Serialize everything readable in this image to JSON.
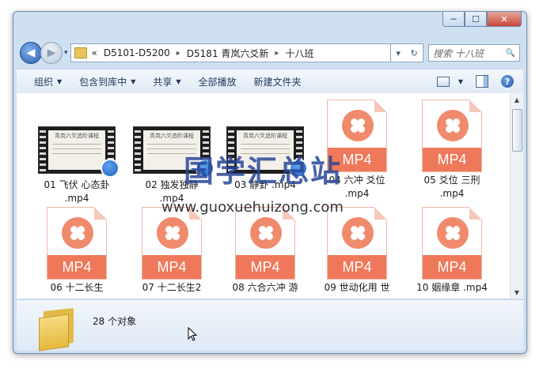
{
  "window": {
    "controls": {
      "minimize": "─",
      "maximize": "☐",
      "close": "✕"
    }
  },
  "address": {
    "back": "◀",
    "forward": "▶",
    "history": "▾",
    "overflow": "«",
    "crumbs": [
      "D5101-D5200",
      "D5181 青岚六爻新",
      "十八班"
    ],
    "separator": "▸",
    "dropdown": "▾",
    "refresh": "↻",
    "search_placeholder": "搜索 十八班",
    "search_icon": "🔍"
  },
  "toolbar": {
    "organize": "组织",
    "include_library": "包含到库中",
    "share": "共享",
    "play_all": "全部播放",
    "new_folder": "新建文件夹",
    "help": "?"
  },
  "thumb_caption": "青岚六爻追阶课程",
  "files": [
    {
      "name": "01 飞伏 心态卦",
      "ext": ".mp4"
    },
    {
      "name": "02 独发独静",
      "ext": ".mp4"
    },
    {
      "name": "03 静卦 .mp4",
      "ext": ""
    },
    {
      "name": "04 六冲 爻位",
      "ext": ".mp4"
    },
    {
      "name": "05 爻位 三刑",
      "ext": ".mp4"
    },
    {
      "name": "06 十二长生",
      "ext": ""
    },
    {
      "name": "07 十二长生2",
      "ext": ""
    },
    {
      "name": "08 六合六冲 游",
      "ext": ""
    },
    {
      "name": "09 世动化用 世",
      "ext": ""
    },
    {
      "name": "10 姻缘章 .mp4",
      "ext": ""
    }
  ],
  "mp4_label": "MP4",
  "status": {
    "count": "28 个对象"
  },
  "watermark": {
    "title": "国学汇总站",
    "url": "www.guoxuehuizong.com"
  }
}
